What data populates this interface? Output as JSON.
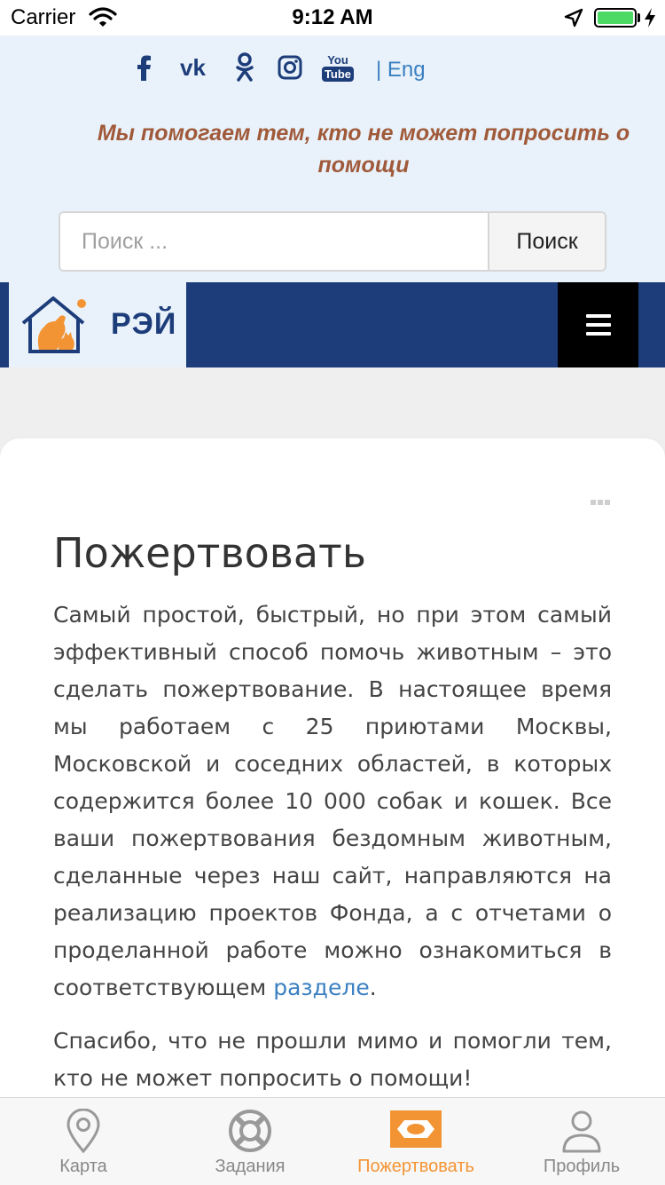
{
  "status": {
    "carrier": "Carrier",
    "time": "9:12 AM"
  },
  "header": {
    "social_icons": [
      "facebook-icon",
      "vk-icon",
      "odnoklassniki-icon",
      "instagram-icon",
      "youtube-icon"
    ],
    "youtube_you": "You",
    "youtube_tube": "Tube",
    "lang_link": "| Eng",
    "tagline": "Мы помогаем тем, кто не может попросить о помощи",
    "search": {
      "placeholder": "Поиск ...",
      "value": "",
      "button": "Поиск"
    }
  },
  "nav": {
    "brand": "РЭЙ"
  },
  "content": {
    "title": "Пожертвовать",
    "para1_text": "Самый простой, быстрый, но при этом самый эффективный способ помочь животным – это сделать пожертвование. В настоящее время мы работаем с 25 приютами Москвы, Московской и соседних областей, в которых содержится более 10 000 собак и кошек. Все ваши пожертвования бездомным животным, сделанные через наш сайт, направляются на реализацию проектов Фонда, а с отчетами о проделанной работе можно ознакомиться в соответствующем ",
    "para1_link": "разделе",
    "para1_end": ".",
    "para2": "Спасибо, что не прошли мимо и помогли тем, кто не может попросить о помощи!"
  },
  "tabs": [
    {
      "label": "Карта",
      "icon": "map-pin-icon"
    },
    {
      "label": "Задания",
      "icon": "lifebuoy-icon"
    },
    {
      "label": "Пожертвовать",
      "icon": "donate-icon"
    },
    {
      "label": "Профиль",
      "icon": "profile-icon"
    }
  ],
  "colors": {
    "accent": "#f39434",
    "nav": "#1c3d7a",
    "header_bg": "#e9f2fb",
    "tagline": "#a05a3a",
    "link": "#3a7fc1"
  }
}
